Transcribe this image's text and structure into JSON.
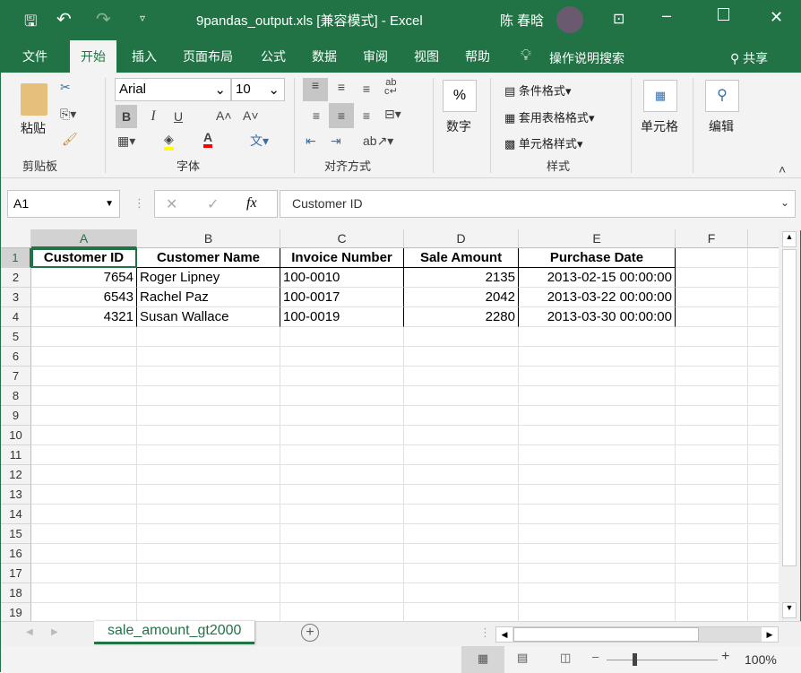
{
  "title": {
    "filename": "9pandas_output.xls",
    "mode": "[兼容模式]",
    "sep": "-",
    "app": "Excel",
    "user": "陈 春晗"
  },
  "tabs": [
    "文件",
    "开始",
    "插入",
    "页面布局",
    "公式",
    "数据",
    "审阅",
    "视图",
    "帮助"
  ],
  "tell_me": "操作说明搜索",
  "share": "共享",
  "ribbon": {
    "paste": "粘贴",
    "clipboard": "剪贴板",
    "font_name": "Arial",
    "font_size": "10",
    "font_group": "字体",
    "bold": "B",
    "italic": "I",
    "underline": "U",
    "align_group": "对齐方式",
    "number": "数字",
    "number_symbol": "%",
    "cond_format": "条件格式",
    "table_format": "套用表格格式",
    "cell_style": "单元格样式",
    "styles_group": "样式",
    "cells": "单元格",
    "editing": "编辑"
  },
  "formula_bar": {
    "name_box": "A1",
    "fx": "fx",
    "content": "Customer ID"
  },
  "columns": [
    "A",
    "B",
    "C",
    "D",
    "E",
    "F"
  ],
  "rows": [
    "1",
    "2",
    "3",
    "4",
    "5",
    "6",
    "7",
    "8",
    "9",
    "10",
    "11",
    "12",
    "13",
    "14",
    "15",
    "16",
    "17",
    "18",
    "19"
  ],
  "table": {
    "headers": [
      "Customer ID",
      "Customer Name",
      "Invoice Number",
      "Sale Amount",
      "Purchase Date"
    ],
    "data": [
      [
        "7654",
        "Roger Lipney",
        "100-0010",
        "2135",
        "2013-02-15 00:00:00"
      ],
      [
        "6543",
        "Rachel Paz",
        "100-0017",
        "2042",
        "2013-03-22 00:00:00"
      ],
      [
        "4321",
        "Susan Wallace",
        "100-0019",
        "2280",
        "2013-03-30 00:00:00"
      ]
    ]
  },
  "sheet_tab": "sale_amount_gt2000",
  "status": {
    "zoom": "100%",
    "zoom_value": 100
  },
  "colors": {
    "brand": "#217346",
    "fill_color": "#ffff00",
    "font_color": "#ff0000"
  }
}
